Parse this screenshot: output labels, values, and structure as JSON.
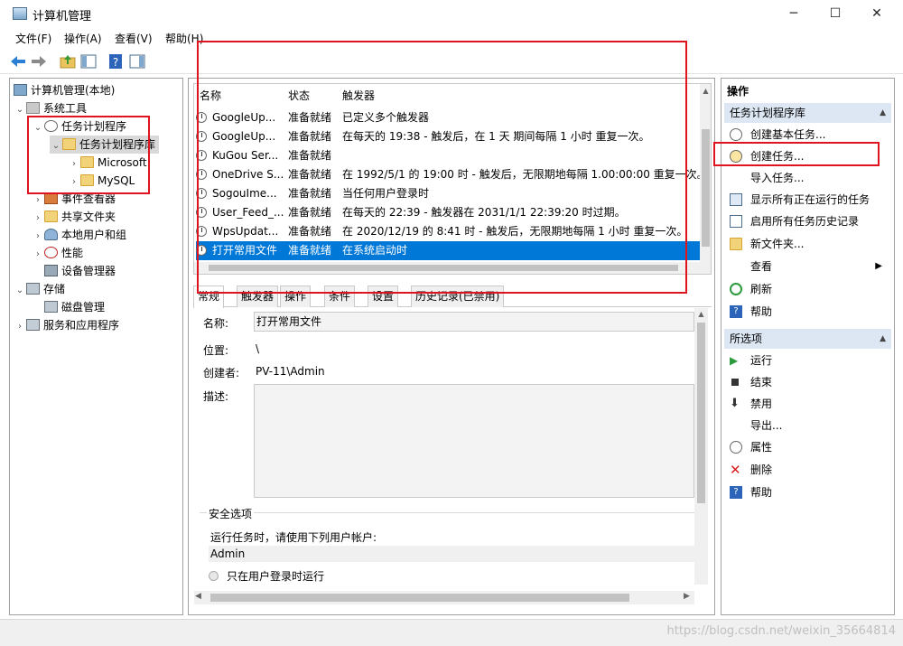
{
  "window": {
    "title": "计算机管理",
    "minimize": "─",
    "maximize": "☐",
    "close": "✕"
  },
  "menu": [
    "文件(F)",
    "操作(A)",
    "查看(V)",
    "帮助(H)"
  ],
  "tree": {
    "root": "计算机管理(本地)",
    "system_tools": "系统工具",
    "task_scheduler": "任务计划程序",
    "task_library": "任务计划程序库",
    "microsoft": "Microsoft",
    "mysql": "MySQL",
    "event_viewer": "事件查看器",
    "shared_folders": "共享文件夹",
    "local_users": "本地用户和组",
    "performance": "性能",
    "device_manager": "设备管理器",
    "storage": "存储",
    "disk_management": "磁盘管理",
    "services_apps": "服务和应用程序"
  },
  "tasklist": {
    "columns": [
      "名称",
      "状态",
      "触发器"
    ],
    "rows": [
      {
        "name": "GoogleUp...",
        "status": "准备就绪",
        "trigger": "已定义多个触发器"
      },
      {
        "name": "GoogleUp...",
        "status": "准备就绪",
        "trigger": "在每天的 19:38 - 触发后，在 1 天 期间每隔 1 小时 重复一次。"
      },
      {
        "name": "KuGou Ser...",
        "status": "准备就绪",
        "trigger": ""
      },
      {
        "name": "OneDrive S...",
        "status": "准备就绪",
        "trigger": "在 1992/5/1 的 19:00 时 - 触发后，无限期地每隔 1.00:00:00 重复一次。"
      },
      {
        "name": "SogouIme...",
        "status": "准备就绪",
        "trigger": "当任何用户登录时"
      },
      {
        "name": "User_Feed_...",
        "status": "准备就绪",
        "trigger": "在每天的 22:39 - 触发器在 2031/1/1 22:39:20 时过期。"
      },
      {
        "name": "WpsUpdat...",
        "status": "准备就绪",
        "trigger": "在 2020/12/19 的 8:41 时 - 触发后，无限期地每隔 1 小时 重复一次。"
      },
      {
        "name": "打开常用文件",
        "status": "准备就绪",
        "trigger": "在系统启动时"
      }
    ]
  },
  "tabs": [
    "常规",
    "触发器",
    "操作",
    "条件",
    "设置",
    "历史记录(已禁用)"
  ],
  "details": {
    "name_label": "名称:",
    "name_value": "打开常用文件",
    "location_label": "位置:",
    "location_value": "\\",
    "author_label": "创建者:",
    "author_value": "PV-11\\Admin",
    "description_label": "描述:",
    "security_title": "安全选项",
    "run_as_text": "运行任务时，请使用下列用户帐户:",
    "account": "Admin",
    "only_logged_on": "只在用户登录时运行"
  },
  "actions": {
    "header": "操作",
    "section1": "任务计划程序库",
    "items1": [
      "创建基本任务...",
      "创建任务...",
      "导入任务...",
      "显示所有正在运行的任务",
      "启用所有任务历史记录",
      "新文件夹...",
      "查看",
      "刷新",
      "帮助"
    ],
    "section2": "所选项",
    "items2": [
      "运行",
      "结束",
      "禁用",
      "导出...",
      "属性",
      "删除",
      "帮助"
    ]
  },
  "watermark": "https://blog.csdn.net/weixin_35664814",
  "colors": {
    "selection": "#0078d7",
    "annotation": "#e0141e",
    "section_bg": "#dde7f3"
  }
}
